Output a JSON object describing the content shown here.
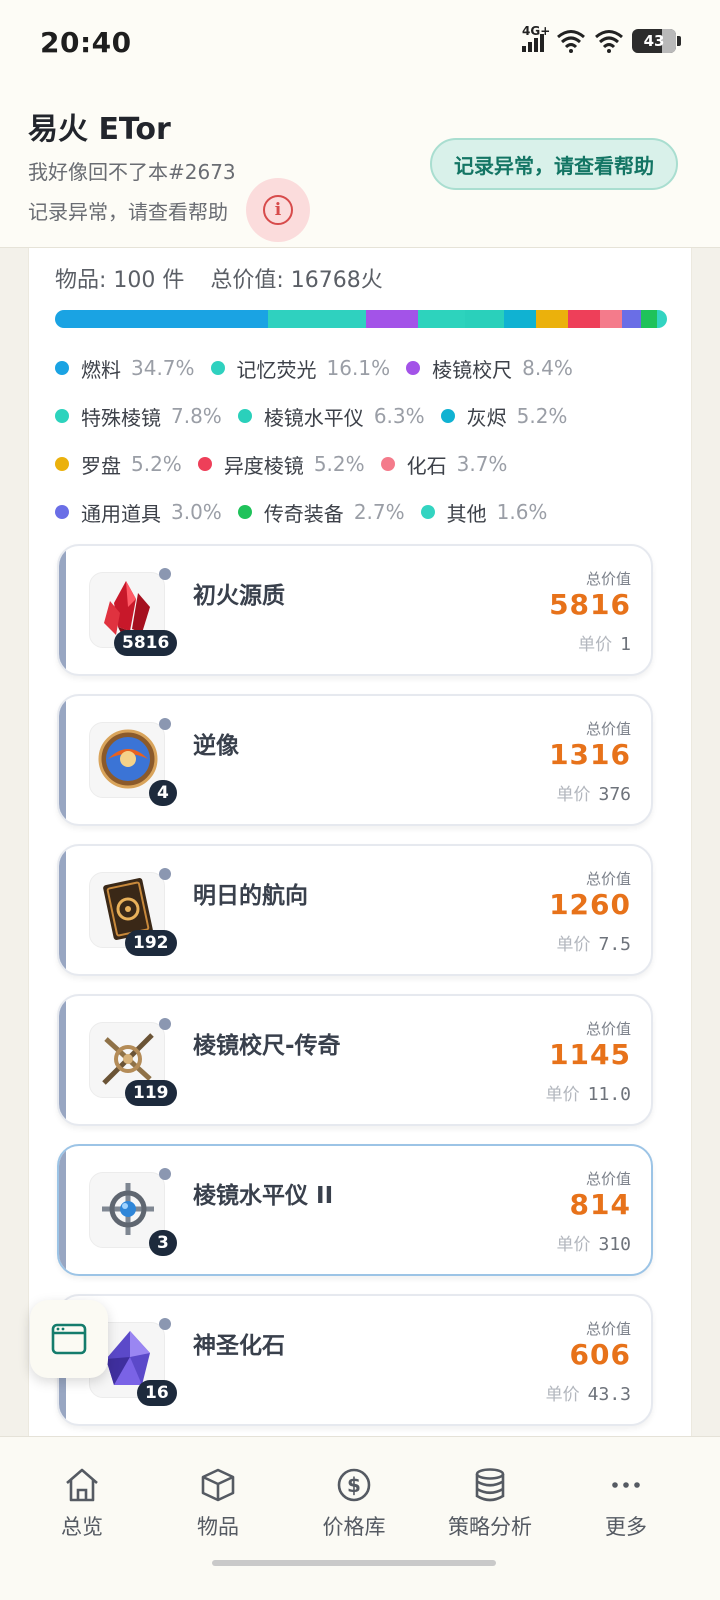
{
  "status_bar": {
    "time": "20:40",
    "network": "4G+",
    "battery": "43"
  },
  "header": {
    "user_name": "易火 ETor",
    "subtitle": "我好像回不了本#2673",
    "warning_text": "记录异常，请查看帮助",
    "warning_button": "记录异常，请查看帮助"
  },
  "summary": {
    "items": "物品: 100 件",
    "total_value": "总价值: 16768火"
  },
  "distribution": [
    {
      "name": "燃料",
      "pct": "34.7%",
      "value": 34.7,
      "color": "#1aa3e3"
    },
    {
      "name": "记忆荧光",
      "pct": "16.1%",
      "value": 16.1,
      "color": "#2fd1bf"
    },
    {
      "name": "棱镜校尺",
      "pct": "8.4%",
      "value": 8.4,
      "color": "#a353e8"
    },
    {
      "name": "特殊棱镜",
      "pct": "7.8%",
      "value": 7.8,
      "color": "#2dd3bd"
    },
    {
      "name": "棱镜水平仪",
      "pct": "6.3%",
      "value": 6.3,
      "color": "#2ad0bb"
    },
    {
      "name": "灰烬",
      "pct": "5.2%",
      "value": 5.2,
      "color": "#10b2d2"
    },
    {
      "name": "罗盘",
      "pct": "5.2%",
      "value": 5.2,
      "color": "#ebb10c"
    },
    {
      "name": "异度棱镜",
      "pct": "5.2%",
      "value": 5.2,
      "color": "#ee3f59"
    },
    {
      "name": "化石",
      "pct": "3.7%",
      "value": 3.7,
      "color": "#f47b8b"
    },
    {
      "name": "通用道具",
      "pct": "3.0%",
      "value": 3.0,
      "color": "#6a6ee6"
    },
    {
      "name": "传奇装备",
      "pct": "2.7%",
      "value": 2.7,
      "color": "#1fc25a"
    },
    {
      "name": "其他",
      "pct": "1.6%",
      "value": 1.6,
      "color": "#33d4c1"
    }
  ],
  "item_labels": {
    "total": "总价值",
    "unit": "单价"
  },
  "items": [
    {
      "name": "初火源质",
      "count": "5816",
      "total": "5816",
      "unit_price": "1",
      "icon": "red-crystal-icon"
    },
    {
      "name": "逆像",
      "count": "4",
      "total": "1316",
      "unit_price": "376",
      "icon": "mirror-orb-icon"
    },
    {
      "name": "明日的航向",
      "count": "192",
      "total": "1260",
      "unit_price": "7.5",
      "icon": "compass-card-icon"
    },
    {
      "name": "棱镜校尺-传奇",
      "count": "119",
      "total": "1145",
      "unit_price": "11.0",
      "icon": "prism-ruler-icon"
    },
    {
      "name": "棱镜水平仪 II",
      "count": "3",
      "total": "814",
      "unit_price": "310",
      "icon": "prism-level-icon"
    },
    {
      "name": "神圣化石",
      "count": "16",
      "total": "606",
      "unit_price": "43.3",
      "icon": "fossil-crystal-icon"
    }
  ],
  "nav": [
    {
      "label": "总览",
      "icon": "home-icon"
    },
    {
      "label": "物品",
      "icon": "cube-icon"
    },
    {
      "label": "价格库",
      "icon": "dollar-circle-icon"
    },
    {
      "label": "策略分析",
      "icon": "database-icon"
    },
    {
      "label": "更多",
      "icon": "more-dots-icon"
    }
  ]
}
